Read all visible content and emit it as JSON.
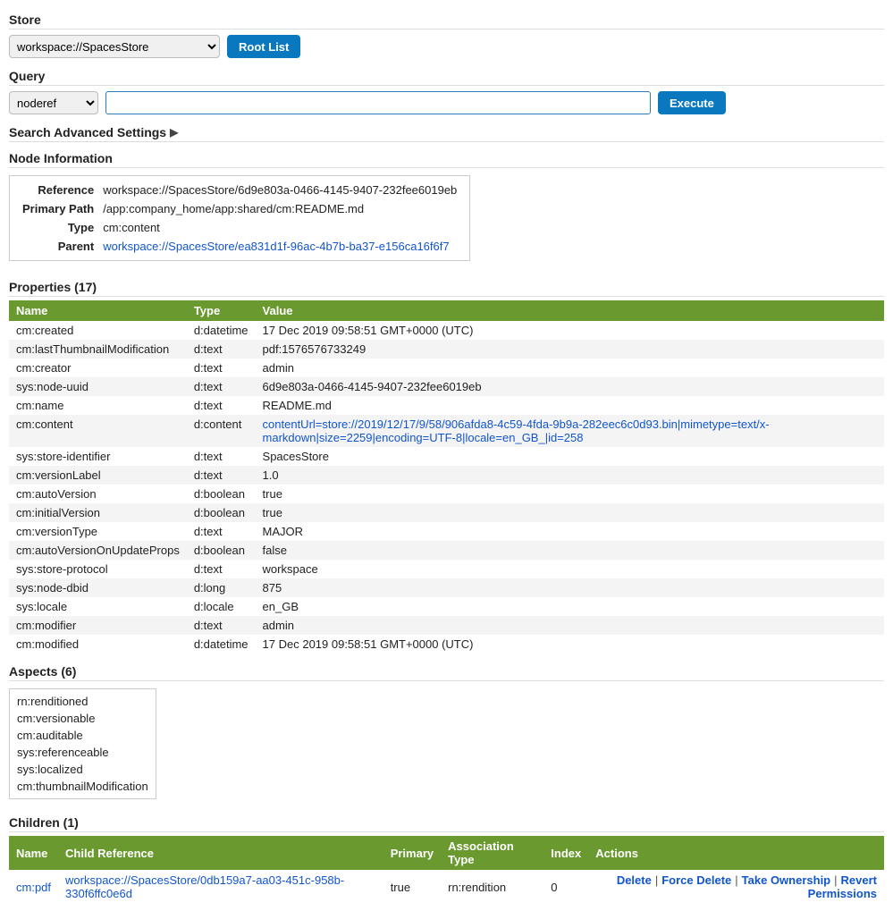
{
  "store": {
    "label": "Store",
    "selected": "workspace://SpacesStore",
    "root_list_button": "Root List"
  },
  "query": {
    "label": "Query",
    "type_selected": "noderef",
    "input_value": "",
    "execute_button": "Execute"
  },
  "advanced": {
    "label": "Search Advanced Settings"
  },
  "node_info": {
    "heading": "Node Information",
    "labels": {
      "reference": "Reference",
      "primary_path": "Primary Path",
      "type": "Type",
      "parent": "Parent"
    },
    "reference": "workspace://SpacesStore/6d9e803a-0466-4145-9407-232fee6019eb",
    "primary_path": "/app:company_home/app:shared/cm:README.md",
    "type": "cm:content",
    "parent": "workspace://SpacesStore/ea831d1f-96ac-4b7b-ba37-e156ca16f6f7"
  },
  "properties": {
    "heading": "Properties (17)",
    "columns": {
      "name": "Name",
      "type": "Type",
      "value": "Value"
    },
    "rows": [
      {
        "name": "cm:created",
        "type": "d:datetime",
        "value": "17 Dec 2019 09:58:51 GMT+0000 (UTC)",
        "link": false
      },
      {
        "name": "cm:lastThumbnailModification",
        "type": "d:text",
        "value": "pdf:1576576733249",
        "link": false
      },
      {
        "name": "cm:creator",
        "type": "d:text",
        "value": "admin",
        "link": false
      },
      {
        "name": "sys:node-uuid",
        "type": "d:text",
        "value": "6d9e803a-0466-4145-9407-232fee6019eb",
        "link": false
      },
      {
        "name": "cm:name",
        "type": "d:text",
        "value": "README.md",
        "link": false
      },
      {
        "name": "cm:content",
        "type": "d:content",
        "value": "contentUrl=store://2019/12/17/9/58/906afda8-4c59-4fda-9b9a-282eec6c0d93.bin|mimetype=text/x-markdown|size=2259|encoding=UTF-8|locale=en_GB_|id=258",
        "link": true
      },
      {
        "name": "sys:store-identifier",
        "type": "d:text",
        "value": "SpacesStore",
        "link": false
      },
      {
        "name": "cm:versionLabel",
        "type": "d:text",
        "value": "1.0",
        "link": false
      },
      {
        "name": "cm:autoVersion",
        "type": "d:boolean",
        "value": "true",
        "link": false
      },
      {
        "name": "cm:initialVersion",
        "type": "d:boolean",
        "value": "true",
        "link": false
      },
      {
        "name": "cm:versionType",
        "type": "d:text",
        "value": "MAJOR",
        "link": false
      },
      {
        "name": "cm:autoVersionOnUpdateProps",
        "type": "d:boolean",
        "value": "false",
        "link": false
      },
      {
        "name": "sys:store-protocol",
        "type": "d:text",
        "value": "workspace",
        "link": false
      },
      {
        "name": "sys:node-dbid",
        "type": "d:long",
        "value": "875",
        "link": false
      },
      {
        "name": "sys:locale",
        "type": "d:locale",
        "value": "en_GB",
        "link": false
      },
      {
        "name": "cm:modifier",
        "type": "d:text",
        "value": "admin",
        "link": false
      },
      {
        "name": "cm:modified",
        "type": "d:datetime",
        "value": "17 Dec 2019 09:58:51 GMT+0000 (UTC)",
        "link": false
      }
    ]
  },
  "aspects": {
    "heading": "Aspects (6)",
    "items": [
      "rn:renditioned",
      "cm:versionable",
      "cm:auditable",
      "sys:referenceable",
      "sys:localized",
      "cm:thumbnailModification"
    ]
  },
  "children": {
    "heading": "Children (1)",
    "columns": {
      "name": "Name",
      "child_ref": "Child Reference",
      "primary": "Primary",
      "assoc_type": "Association Type",
      "index": "Index",
      "actions": "Actions"
    },
    "rows": [
      {
        "name": "cm:pdf",
        "child_ref": "workspace://SpacesStore/0db159a7-aa03-451c-958b-330f6ffc0e6d",
        "primary": "true",
        "assoc_type": "rn:rendition",
        "index": "0"
      }
    ],
    "actions": {
      "delete": "Delete",
      "force_delete": "Force Delete",
      "take_ownership": "Take Ownership",
      "revert_permissions": "Revert Permissions"
    }
  }
}
